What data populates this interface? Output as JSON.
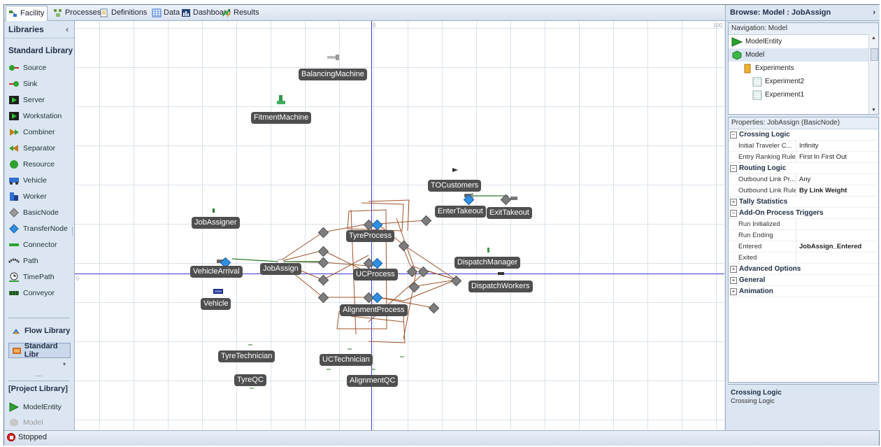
{
  "tabs": [
    {
      "label": "Facility",
      "icon": "facility-icon"
    },
    {
      "label": "Processes",
      "icon": "processes-icon"
    },
    {
      "label": "Definitions",
      "icon": "definitions-icon"
    },
    {
      "label": "Data",
      "icon": "data-icon"
    },
    {
      "label": "Dashboard",
      "icon": "dashboard-icon"
    },
    {
      "label": "Results",
      "icon": "results-icon"
    }
  ],
  "libraries": {
    "header": "Libraries",
    "collapse": "‹",
    "standard_title": "Standard Library",
    "items": [
      {
        "label": "Source",
        "icon": "source-icon"
      },
      {
        "label": "Sink",
        "icon": "sink-icon"
      },
      {
        "label": "Server",
        "icon": "server-icon"
      },
      {
        "label": "Workstation",
        "icon": "workstation-icon"
      },
      {
        "label": "Combiner",
        "icon": "combiner-icon"
      },
      {
        "label": "Separator",
        "icon": "separator-icon"
      },
      {
        "label": "Resource",
        "icon": "resource-icon"
      },
      {
        "label": "Vehicle",
        "icon": "vehicle-icon"
      },
      {
        "label": "Worker",
        "icon": "worker-icon"
      },
      {
        "label": "BasicNode",
        "icon": "basicnode-icon"
      },
      {
        "label": "TransferNode",
        "icon": "transfernode-icon"
      },
      {
        "label": "Connector",
        "icon": "connector-icon"
      },
      {
        "label": "Path",
        "icon": "path-icon"
      },
      {
        "label": "TimePath",
        "icon": "timepath-icon"
      },
      {
        "label": "Conveyor",
        "icon": "conveyor-icon"
      }
    ],
    "flow_library": "Flow Library",
    "standard_library_btn": "Standard Libr",
    "more_dots": "....",
    "project_title": "[Project Library]",
    "project_items": [
      {
        "label": "ModelEntity",
        "icon": "modelentity-icon"
      },
      {
        "label": "Model",
        "icon": "model-icon"
      }
    ]
  },
  "canvas": {
    "axis_top_label": "0",
    "axis_right_label": "100",
    "axis_left_label": "0",
    "objects": {
      "balancing": "BalancingMachine",
      "fitment": "FitmentMachine",
      "tocustomers": "TOCustomers",
      "entertakeout": "EnterTakeout",
      "exittakeout": "ExitTakeout",
      "jobassigner": "JobAssigner",
      "tyreprocess": "TyreProcess",
      "dispatchmanager": "DispatchManager",
      "vehiclearrival": "VehicleArrival",
      "jobassign": "JobAssign",
      "ucprocess": "UCProcess",
      "dispatchworkers": "DispatchWorkers",
      "vehicle": "Vehicle",
      "alignmentprocess": "AlignmentProcess",
      "tyretechnician": "TyreTechnician",
      "uctechnician": "UCTechnician",
      "tyreqc": "TyreQC",
      "alignmentqc": "AlignmentQC"
    }
  },
  "browse": {
    "title": "Browse: Model : JobAssign",
    "arrow": "›",
    "navigation_title": "Navigation: Model",
    "tree": [
      {
        "label": "ModelEntity",
        "icon": "modelentity-icon",
        "indent": 0
      },
      {
        "label": "Model",
        "icon": "model-icon",
        "indent": 0
      },
      {
        "label": "Experiments",
        "icon": "folder-icon",
        "indent": 1
      },
      {
        "label": "Experiment2",
        "icon": "experiment-icon",
        "indent": 2
      },
      {
        "label": "Experiment1",
        "icon": "experiment-icon",
        "indent": 2
      }
    ]
  },
  "properties": {
    "title": "Properties: JobAssign (BasicNode)",
    "crossing": {
      "label": "Crossing Logic",
      "rows": [
        {
          "k": "Initial Traveler C...",
          "v": "Infinity"
        },
        {
          "k": "Entry Ranking Rule",
          "v": "First In First Out"
        }
      ]
    },
    "routing": {
      "label": "Routing Logic",
      "rows": [
        {
          "k": "Outbound Link Pr...",
          "v": "Any"
        },
        {
          "k": "Outbound Link Rule",
          "v": "By Link Weight"
        }
      ]
    },
    "tally": "Tally Statistics",
    "addon": {
      "label": "Add-On Process Triggers",
      "rows": [
        {
          "k": "Run Initialized",
          "v": ""
        },
        {
          "k": "Run Ending",
          "v": ""
        },
        {
          "k": "Entered",
          "v": "JobAssign_Entered"
        },
        {
          "k": "Exited",
          "v": ""
        }
      ]
    },
    "advanced": "Advanced Options",
    "general": "General",
    "animation": "Animation",
    "plus": "+",
    "minus": "−"
  },
  "description": {
    "title": "Crossing Logic",
    "text": "Crossing Logic"
  },
  "status": {
    "text": "Stopped"
  },
  "colors": {
    "accent": "#3a3ad0",
    "link": "#a0532a",
    "transfer": "#2f8fe0",
    "label_bg": "#4f4f4f"
  }
}
